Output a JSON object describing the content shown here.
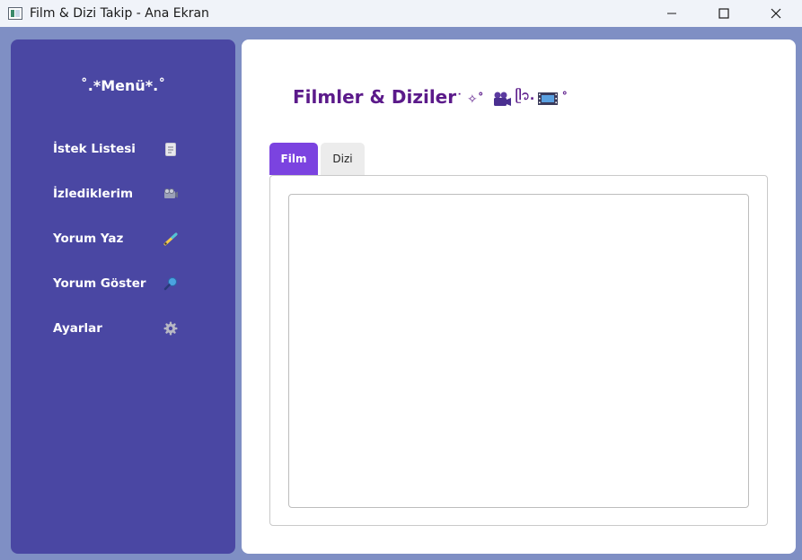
{
  "window": {
    "title": "Film & Dizi Takip - Ana Ekran",
    "app_icon": "window-app-icon",
    "controls": [
      "minimize-icon",
      "maximize-icon",
      "close-icon"
    ]
  },
  "sidebar": {
    "title": "˚.*Menü*.˚",
    "background": "#4a47a3",
    "items": [
      {
        "label": "İstek Listesi",
        "icon": "document-icon"
      },
      {
        "label": "İzlediklerim",
        "icon": "film-reel-icon"
      },
      {
        "label": "Yorum Yaz",
        "icon": "pen-icon"
      },
      {
        "label": "Yorum Göster",
        "icon": "magnifier-icon"
      },
      {
        "label": "Ayarlar",
        "icon": "gear-icon"
      }
    ]
  },
  "main": {
    "title": "Filmler & Diziler",
    "title_decoration": "˙ ✧˚",
    "title_decoration_2": "ᥫ᭡.",
    "title_decoration_end": "˚",
    "title_color": "#5b1a8a",
    "tabs": [
      {
        "label": "Film",
        "active": true
      },
      {
        "label": "Dizi",
        "active": false
      }
    ],
    "accent": "#7b43e0"
  }
}
